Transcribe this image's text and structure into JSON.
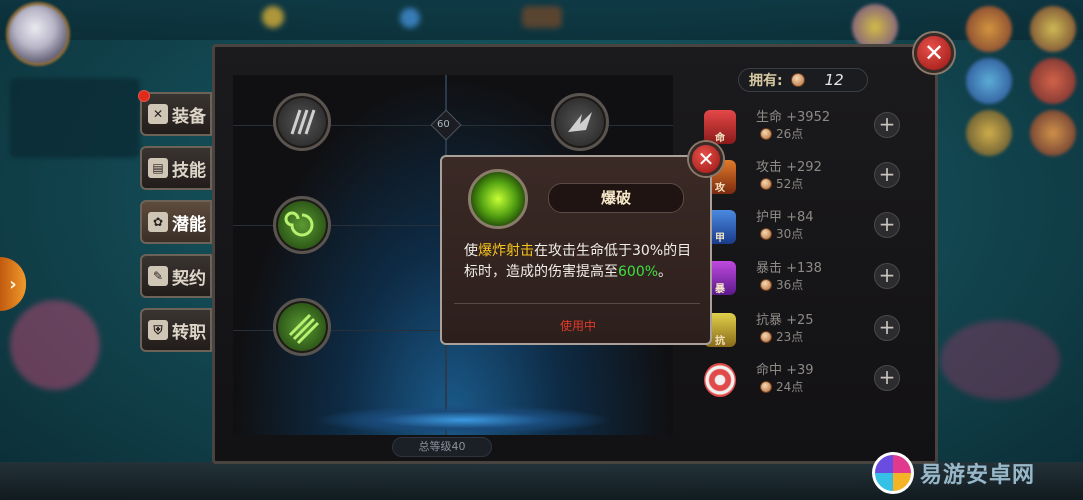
{
  "side_tabs": [
    {
      "label": "装备",
      "icon": "swords-icon"
    },
    {
      "label": "技能",
      "icon": "book-icon"
    },
    {
      "label": "潜能",
      "icon": "gear-icon",
      "active": true
    },
    {
      "label": "契约",
      "icon": "contract-icon"
    },
    {
      "label": "转职",
      "icon": "shield-icon"
    }
  ],
  "tree": {
    "level_markers": [
      "60"
    ],
    "total_level": "总等级40"
  },
  "owned": {
    "label": "拥有:",
    "value": "12"
  },
  "stats": [
    {
      "name": "生命 +3952",
      "cost": "26点",
      "icon_label": "命"
    },
    {
      "name": "攻击 +292",
      "cost": "52点",
      "icon_label": "攻"
    },
    {
      "name": "护甲 +84",
      "cost": "30点",
      "icon_label": "甲"
    },
    {
      "name": "暴击 +138",
      "cost": "36点",
      "icon_label": "暴"
    },
    {
      "name": "抗暴 +25",
      "cost": "23点",
      "icon_label": "抗"
    },
    {
      "name": "命中 +39",
      "cost": "24点",
      "icon_label": ""
    }
  ],
  "popup": {
    "title": "爆破",
    "desc_prefix": "使",
    "desc_highlight": "爆炸射击",
    "desc_mid": "在攻击生命低于30%的目标时，造成的伤害提高至",
    "desc_value": "600%",
    "desc_suffix": "。",
    "status": "使用中"
  },
  "watermark": "易游安卓网",
  "colors": {
    "accent": "#e23a2a",
    "highlight": "#f7c51e",
    "value_green": "#3fe03f"
  }
}
